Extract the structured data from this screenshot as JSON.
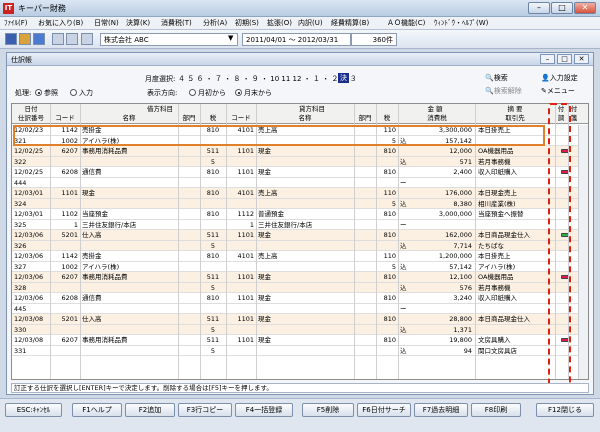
{
  "window": {
    "title": "キーパー財務",
    "icon": "IT",
    "min": "–",
    "max": "□",
    "close": "✕"
  },
  "menu": [
    "ﾌｧｲﾙ(F)",
    "お気に入り(B)",
    "日常(N)",
    "決算(K)",
    "消費税(T)",
    "分析(A)",
    "初期(S)",
    "拡張(O)",
    "内訳(U)",
    "経費精算(B)",
    "ＡＯ機能(C)",
    "ｳｨﾝﾄﾞｳ・ﾍﾙﾌﾟ(W)"
  ],
  "toolbar": {
    "company": "株式会社 ABC",
    "period": "2011/04/01 ～ 2012/03/31",
    "count": "360件"
  },
  "child": {
    "title": "仕訳帳",
    "month_label": "月度選択:",
    "months": "４ ５ ６ ・ ７ ・ ８ ・ ９ ・ 10 11 12 ・ １ ・ ２ ・ ３",
    "month_selected": "決",
    "process_label": "処理:",
    "process_opts": [
      "参照",
      "入力"
    ],
    "display_label": "表示方向:",
    "display_opts": [
      "月初から",
      "月末から"
    ],
    "search": "検索",
    "search_cancel": "検索解除",
    "input_settings": "入力設定",
    "menu_btn": "メニュー"
  },
  "header": {
    "top": [
      "日付",
      "借方科目",
      "貸方科目",
      "金 額",
      "摘 要",
      "付",
      "付"
    ],
    "bottom": [
      "仕訳番号",
      "コード",
      "名称",
      "部門",
      "税",
      "コード",
      "名称",
      "部門",
      "税",
      "消費税",
      "取引先",
      "調",
      "箋"
    ]
  },
  "rows": [
    {
      "a": "12/02/23",
      "b": "1142",
      "c": "売掛金",
      "d": "",
      "e": "810",
      "f": "4101",
      "g": "売上高",
      "h": "",
      "i": "110",
      "j": "",
      "k": "3,300,000",
      "l": "本日掛売上",
      "m": ""
    },
    {
      "a": "321",
      "b": "1002",
      "c": "アイハラ(株)",
      "d": "",
      "e": "",
      "f": "",
      "g": "",
      "h": "",
      "i": "5",
      "j": "込",
      "k": "157,142",
      "l": "",
      "m": ""
    },
    {
      "a": "12/02/25",
      "b": "6207",
      "c": "事務用消耗品費",
      "d": "",
      "e": "511",
      "f": "1101",
      "g": "現金",
      "h": "",
      "i": "810",
      "j": "",
      "k": "12,000",
      "l": "OA機器用品",
      "m": "red"
    },
    {
      "a": "322",
      "b": "",
      "c": "",
      "d": "",
      "e": "5",
      "f": "",
      "g": "",
      "h": "",
      "i": "",
      "j": "込",
      "k": "571",
      "l": "若月事務機",
      "m": ""
    },
    {
      "a": "12/02/25",
      "b": "6208",
      "c": "通信費",
      "d": "",
      "e": "810",
      "f": "1101",
      "g": "現金",
      "h": "",
      "i": "810",
      "j": "",
      "k": "2,400",
      "l": "収入印紙購入",
      "m": "red"
    },
    {
      "a": "444",
      "b": "",
      "c": "",
      "d": "",
      "e": "",
      "f": "",
      "g": "",
      "h": "",
      "i": "",
      "j": "ー",
      "k": "",
      "l": "",
      "m": ""
    },
    {
      "a": "12/03/01",
      "b": "1101",
      "c": "現金",
      "d": "",
      "e": "810",
      "f": "4101",
      "g": "売上高",
      "h": "",
      "i": "110",
      "j": "",
      "k": "176,000",
      "l": "本日現金売上",
      "m": ""
    },
    {
      "a": "324",
      "b": "",
      "c": "",
      "d": "",
      "e": "",
      "f": "",
      "g": "",
      "h": "",
      "i": "5",
      "j": "込",
      "k": "8,380",
      "l": "相川産業(株)",
      "m": ""
    },
    {
      "a": "12/03/01",
      "b": "1102",
      "c": "当座預金",
      "d": "",
      "e": "810",
      "f": "1112",
      "g": "普通預金",
      "h": "",
      "i": "810",
      "j": "",
      "k": "3,000,000",
      "l": "当座預金へ振替",
      "m": ""
    },
    {
      "a": "325",
      "b": "1",
      "c": "三井住友銀行/本店",
      "d": "",
      "e": "",
      "f": "1",
      "g": "三井住友銀行/本店",
      "h": "",
      "i": "",
      "j": "ー",
      "k": "",
      "l": "",
      "m": ""
    },
    {
      "a": "12/03/06",
      "b": "5201",
      "c": "仕入高",
      "d": "",
      "e": "511",
      "f": "1101",
      "g": "現金",
      "h": "",
      "i": "810",
      "j": "",
      "k": "162,000",
      "l": "本日商品現金仕入",
      "m": "green"
    },
    {
      "a": "326",
      "b": "",
      "c": "",
      "d": "",
      "e": "5",
      "f": "",
      "g": "",
      "h": "",
      "i": "",
      "j": "込",
      "k": "7,714",
      "l": "たちばな",
      "m": ""
    },
    {
      "a": "12/03/06",
      "b": "1142",
      "c": "売掛金",
      "d": "",
      "e": "810",
      "f": "4101",
      "g": "売上高",
      "h": "",
      "i": "110",
      "j": "",
      "k": "1,200,000",
      "l": "本日掛売上",
      "m": ""
    },
    {
      "a": "327",
      "b": "1002",
      "c": "アイハラ(株)",
      "d": "",
      "e": "",
      "f": "",
      "g": "",
      "h": "",
      "i": "5",
      "j": "込",
      "k": "57,142",
      "l": "アイハラ(株)",
      "m": ""
    },
    {
      "a": "12/03/06",
      "b": "6207",
      "c": "事務用消耗品費",
      "d": "",
      "e": "511",
      "f": "1101",
      "g": "現金",
      "h": "",
      "i": "810",
      "j": "",
      "k": "12,100",
      "l": "OA機器用品",
      "m": "red"
    },
    {
      "a": "328",
      "b": "",
      "c": "",
      "d": "",
      "e": "5",
      "f": "",
      "g": "",
      "h": "",
      "i": "",
      "j": "込",
      "k": "576",
      "l": "若月事務機",
      "m": ""
    },
    {
      "a": "12/03/06",
      "b": "6208",
      "c": "通信費",
      "d": "",
      "e": "810",
      "f": "1101",
      "g": "現金",
      "h": "",
      "i": "810",
      "j": "",
      "k": "3,240",
      "l": "収入印紙購入",
      "m": ""
    },
    {
      "a": "445",
      "b": "",
      "c": "",
      "d": "",
      "e": "",
      "f": "",
      "g": "",
      "h": "",
      "i": "",
      "j": "ー",
      "k": "",
      "l": "",
      "m": ""
    },
    {
      "a": "12/03/08",
      "b": "5201",
      "c": "仕入高",
      "d": "",
      "e": "511",
      "f": "1101",
      "g": "現金",
      "h": "",
      "i": "810",
      "j": "",
      "k": "28,800",
      "l": "本日商品現金仕入",
      "m": ""
    },
    {
      "a": "330",
      "b": "",
      "c": "",
      "d": "",
      "e": "5",
      "f": "",
      "g": "",
      "h": "",
      "i": "",
      "j": "込",
      "k": "1,371",
      "l": "",
      "m": ""
    },
    {
      "a": "12/03/08",
      "b": "6207",
      "c": "事務用消耗品費",
      "d": "",
      "e": "511",
      "f": "1101",
      "g": "現金",
      "h": "",
      "i": "810",
      "j": "",
      "k": "19,800",
      "l": "文房具購入",
      "m": "red"
    },
    {
      "a": "331",
      "b": "",
      "c": "",
      "d": "",
      "e": "5",
      "f": "",
      "g": "",
      "h": "",
      "i": "",
      "j": "込",
      "k": "94",
      "l": "関口文房具店",
      "m": ""
    }
  ],
  "status": "訂正する仕訳を選択し[ENTER]キーで決定します。削除する場合は[F5]キーを押します。",
  "fkeys": [
    "ESC:ｷｬﾝｾﾙ",
    "F1ヘルプ",
    "F2追加",
    "F3行コピー",
    "F4一括登録",
    "F5削除",
    "F6日付サーチ",
    "F7過去明細",
    "F8印刷",
    "F12閉じる"
  ]
}
